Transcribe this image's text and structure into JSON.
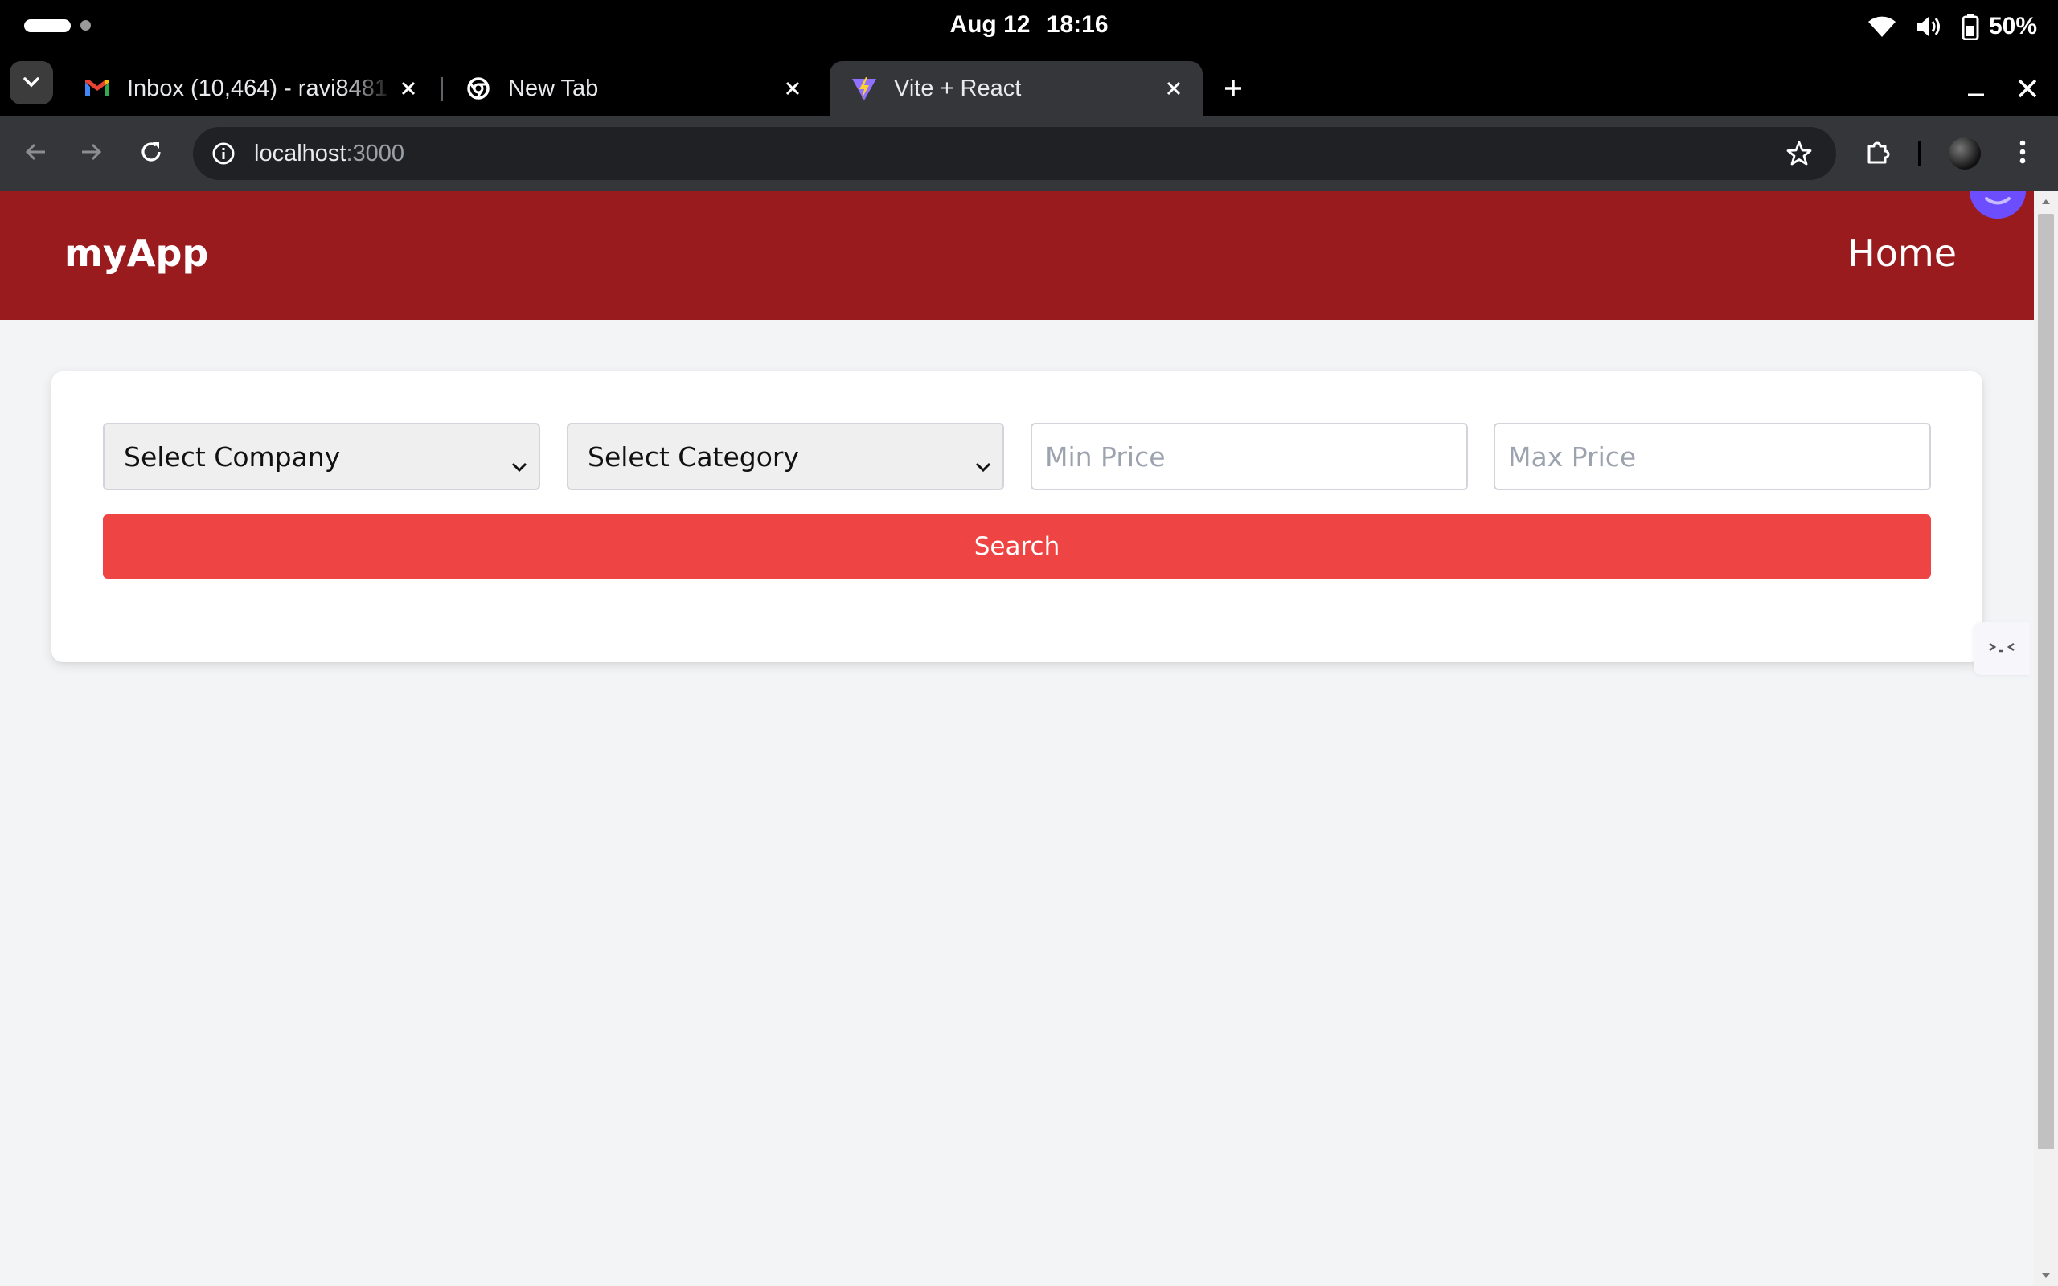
{
  "status_bar": {
    "date": "Aug 12",
    "time": "18:16",
    "battery": "50%",
    "icons": [
      "wifi-icon",
      "volume-icon",
      "battery-icon"
    ]
  },
  "browser": {
    "tabs": [
      {
        "title": "Inbox (10,464) - ravi8481",
        "icon": "gmail-icon",
        "active": false
      },
      {
        "title": "New Tab",
        "icon": "chrome-icon",
        "active": false
      },
      {
        "title": "Vite + React",
        "icon": "vite-icon",
        "active": true
      }
    ],
    "url_host": "localhost",
    "url_port": ":3000",
    "colors": {
      "frame": "#000000",
      "toolbar": "#35363a",
      "omnibox": "#202124"
    }
  },
  "app": {
    "brand": "myApp",
    "nav_home": "Home",
    "colors": {
      "nav": "#991b1e",
      "button": "#ef4444",
      "page_bg": "#f3f4f6"
    },
    "filters": {
      "company_placeholder": "Select Company",
      "category_placeholder": "Select Category",
      "min_price_placeholder": "Min Price",
      "max_price_placeholder": "Max Price",
      "min_price_value": "",
      "max_price_value": ""
    },
    "search_label": "Search"
  }
}
